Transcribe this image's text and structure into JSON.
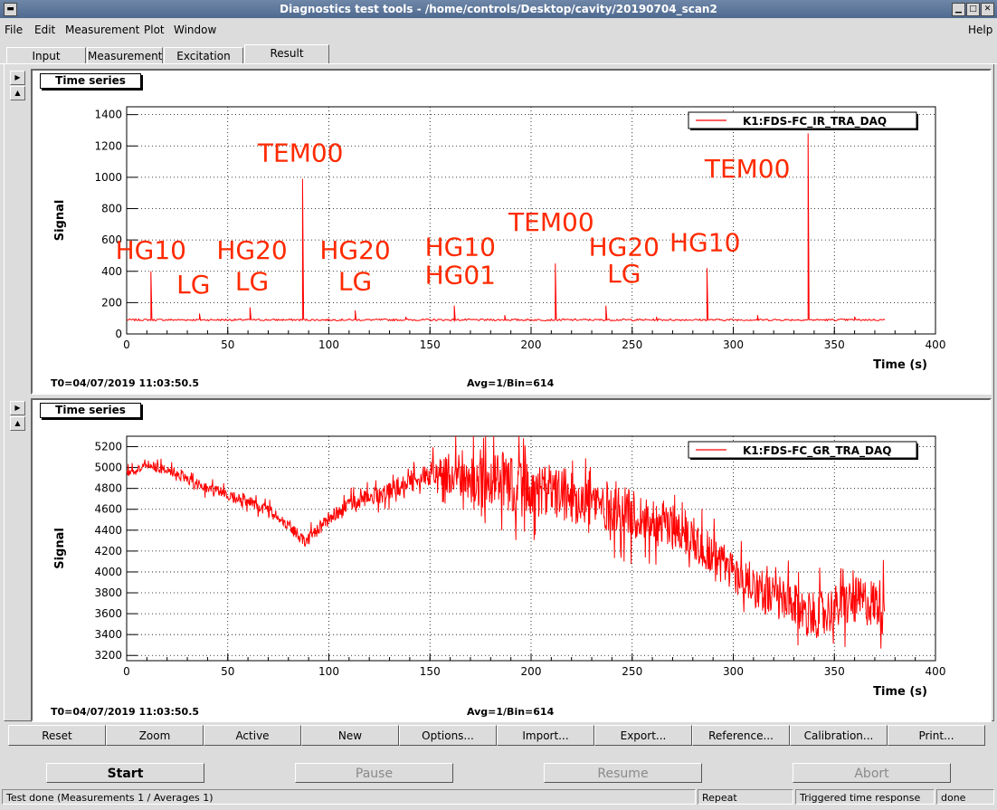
{
  "window": {
    "title": "Diagnostics test tools - /home/controls/Desktop/cavity/20190704_scan2"
  },
  "menu": [
    {
      "label": "File"
    },
    {
      "label": "Edit"
    },
    {
      "label": "Measurement"
    },
    {
      "label": "Plot"
    },
    {
      "label": "Window"
    }
  ],
  "help_label": "Help",
  "tabs": [
    "Input",
    "Measurement",
    "Excitation",
    "Result"
  ],
  "active_tab": "Result",
  "panels": [
    {
      "title": "Time series",
      "legend": "K1:FDS-FC_IR_TRA_DAQ",
      "t0": "T0=04/07/2019 11:03:50.5",
      "avg": "Avg=1/Bin=614"
    },
    {
      "title": "Time series",
      "legend": "K1:FDS-FC_GR_TRA_DAQ",
      "t0": "T0=04/07/2019 11:03:50.5",
      "avg": "Avg=1/Bin=614"
    }
  ],
  "chart_data": [
    {
      "type": "line",
      "title": "Time series",
      "xlabel": "Time (s)",
      "ylabel": "Signal",
      "xlim": [
        0,
        400
      ],
      "ylim": [
        0,
        1450
      ],
      "xticks": [
        0,
        50,
        100,
        150,
        200,
        250,
        300,
        350,
        400
      ],
      "yticks": [
        0,
        200,
        400,
        600,
        800,
        1000,
        1200,
        1400
      ],
      "grid": true,
      "legend_position": "top-right",
      "series": [
        {
          "name": "K1:FDS-FC_IR_TRA_DAQ",
          "color": "#ff0000",
          "baseline": 90,
          "x_end": 375,
          "peaks": [
            [
              12,
              400
            ],
            [
              36,
              130
            ],
            [
              61,
              170
            ],
            [
              87,
              990
            ],
            [
              113,
              150
            ],
            [
              138,
              110
            ],
            [
              162,
              180
            ],
            [
              187,
              120
            ],
            [
              212,
              450
            ],
            [
              237,
              180
            ],
            [
              262,
              110
            ],
            [
              287,
              420
            ],
            [
              312,
              120
            ],
            [
              337,
              1280
            ],
            [
              360,
              110
            ]
          ]
        }
      ],
      "annotations": [
        {
          "text": "HG10",
          "x": 12,
          "y": 480
        },
        {
          "text": "LG",
          "x": 33,
          "y": 260
        },
        {
          "text": "HG20",
          "x": 62,
          "y": 480
        },
        {
          "text": "LG",
          "x": 62,
          "y": 280
        },
        {
          "text": "TEM00",
          "x": 86,
          "y": 1100
        },
        {
          "text": "HG20",
          "x": 113,
          "y": 480
        },
        {
          "text": "LG",
          "x": 113,
          "y": 280
        },
        {
          "text": "HG10",
          "x": 165,
          "y": 500
        },
        {
          "text": "HG01",
          "x": 165,
          "y": 320
        },
        {
          "text": "TEM00",
          "x": 210,
          "y": 660
        },
        {
          "text": "HG20",
          "x": 246,
          "y": 500
        },
        {
          "text": "LG",
          "x": 246,
          "y": 330
        },
        {
          "text": "HG10",
          "x": 286,
          "y": 530
        },
        {
          "text": "TEM00",
          "x": 307,
          "y": 1000
        }
      ]
    },
    {
      "type": "line",
      "title": "Time series",
      "xlabel": "Time (s)",
      "ylabel": "Signal",
      "xlim": [
        0,
        400
      ],
      "ylim": [
        3150,
        5300
      ],
      "xticks": [
        0,
        50,
        100,
        150,
        200,
        250,
        300,
        350,
        400
      ],
      "yticks": [
        3200,
        3400,
        3600,
        3800,
        4000,
        4200,
        4400,
        4600,
        4800,
        5000,
        5200
      ],
      "grid": true,
      "legend_position": "top-right",
      "series": [
        {
          "name": "K1:FDS-FC_GR_TRA_DAQ",
          "color": "#ff0000",
          "trend": [
            [
              0,
              4950
            ],
            [
              10,
              5020
            ],
            [
              20,
              4980
            ],
            [
              40,
              4800
            ],
            [
              60,
              4680
            ],
            [
              75,
              4530
            ],
            [
              88,
              4300
            ],
            [
              100,
              4500
            ],
            [
              110,
              4650
            ],
            [
              130,
              4780
            ],
            [
              150,
              4950
            ],
            [
              175,
              4900
            ],
            [
              200,
              4800
            ],
            [
              225,
              4700
            ],
            [
              250,
              4550
            ],
            [
              275,
              4400
            ],
            [
              300,
              4000
            ],
            [
              320,
              3750
            ],
            [
              340,
              3580
            ],
            [
              360,
              3720
            ],
            [
              375,
              3700
            ]
          ],
          "noise": [
            [
              0,
              60
            ],
            [
              100,
              80
            ],
            [
              150,
              150
            ],
            [
              175,
              350
            ],
            [
              250,
              300
            ],
            [
              300,
              250
            ],
            [
              375,
              300
            ]
          ]
        }
      ]
    }
  ],
  "bottom_buttons": [
    "Reset",
    "Zoom",
    "Active",
    "New",
    "Options...",
    "Import...",
    "Export...",
    "Reference...",
    "Calibration...",
    "Print..."
  ],
  "controls": [
    {
      "label": "Start",
      "enabled": true
    },
    {
      "label": "Pause",
      "enabled": false
    },
    {
      "label": "Resume",
      "enabled": false
    },
    {
      "label": "Abort",
      "enabled": false
    }
  ],
  "status": {
    "main": "Test done (Measurements 1 / Averages 1)",
    "mode": "Repeat",
    "type": "Triggered time response",
    "state": "done"
  }
}
